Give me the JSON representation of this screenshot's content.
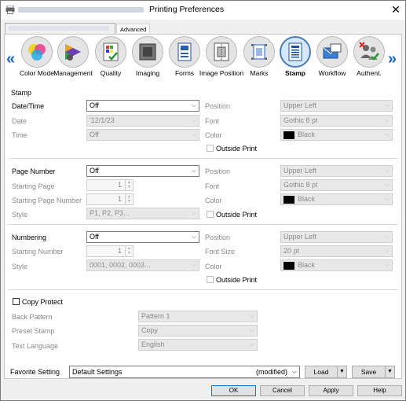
{
  "window": {
    "title": "Printing Preferences",
    "close_glyph": "✕"
  },
  "tabs": {
    "advanced": "Advanced"
  },
  "icons": [
    {
      "label": "Color Mode",
      "name": "color-mode-icon"
    },
    {
      "label": "Management",
      "name": "management-icon"
    },
    {
      "label": "Quality",
      "name": "quality-icon"
    },
    {
      "label": "Imaging",
      "name": "imaging-icon"
    },
    {
      "label": "Forms",
      "name": "forms-icon"
    },
    {
      "label": "Image Position",
      "name": "image-position-icon"
    },
    {
      "label": "Marks",
      "name": "marks-icon"
    },
    {
      "label": "Stamp",
      "name": "stamp-icon",
      "selected": true
    },
    {
      "label": "Workflow",
      "name": "workflow-icon"
    },
    {
      "label": "Authent.",
      "name": "authent-icon"
    }
  ],
  "nav": {
    "left": "«",
    "right": "»"
  },
  "stamp": {
    "section_title": "Stamp",
    "date_time": {
      "label": "Date/Time",
      "value": "Off"
    },
    "date": {
      "label": "Date",
      "value": "'12/1/23"
    },
    "time": {
      "label": "Time",
      "value": "Off"
    },
    "position": {
      "label": "Position",
      "value": "Upper Left"
    },
    "font": {
      "label": "Font",
      "value": "Gothic 8 pt"
    },
    "color": {
      "label": "Color",
      "value": "Black"
    },
    "outside_print": "Outside Print"
  },
  "page_number": {
    "label": "Page Number",
    "value": "Off",
    "starting_page": {
      "label": "Starting Page",
      "value": "1"
    },
    "starting_page_number": {
      "label": "Starting Page Number",
      "value": "1"
    },
    "style": {
      "label": "Style",
      "value": "P1, P2, P3..."
    },
    "position": {
      "label": "Position",
      "value": "Upper Left"
    },
    "font": {
      "label": "Font",
      "value": "Gothic 8 pt"
    },
    "color": {
      "label": "Color",
      "value": "Black"
    },
    "outside_print": "Outside Print"
  },
  "numbering": {
    "label": "Numbering",
    "value": "Off",
    "starting_number": {
      "label": "Starting Number",
      "value": "1"
    },
    "style": {
      "label": "Style",
      "value": "0001, 0002, 0003..."
    },
    "position": {
      "label": "Position",
      "value": "Upper Left"
    },
    "font_size": {
      "label": "Font Size",
      "value": "20 pt"
    },
    "color": {
      "label": "Color",
      "value": "Black"
    },
    "outside_print": "Outside Print"
  },
  "copy_protect": {
    "label": "Copy Protect",
    "back_pattern": {
      "label": "Back Pattern",
      "value": "Pattern 1"
    },
    "preset_stamp": {
      "label": "Preset Stamp",
      "value": "Copy"
    },
    "text_language": {
      "label": "Text Language",
      "value": "English"
    }
  },
  "favorite": {
    "label": "Favorite Setting",
    "value": "Default Settings",
    "modified": "(modified)",
    "load": "Load",
    "save": "Save"
  },
  "buttons": {
    "ok": "OK",
    "cancel": "Cancel",
    "apply": "Apply",
    "help": "Help"
  }
}
